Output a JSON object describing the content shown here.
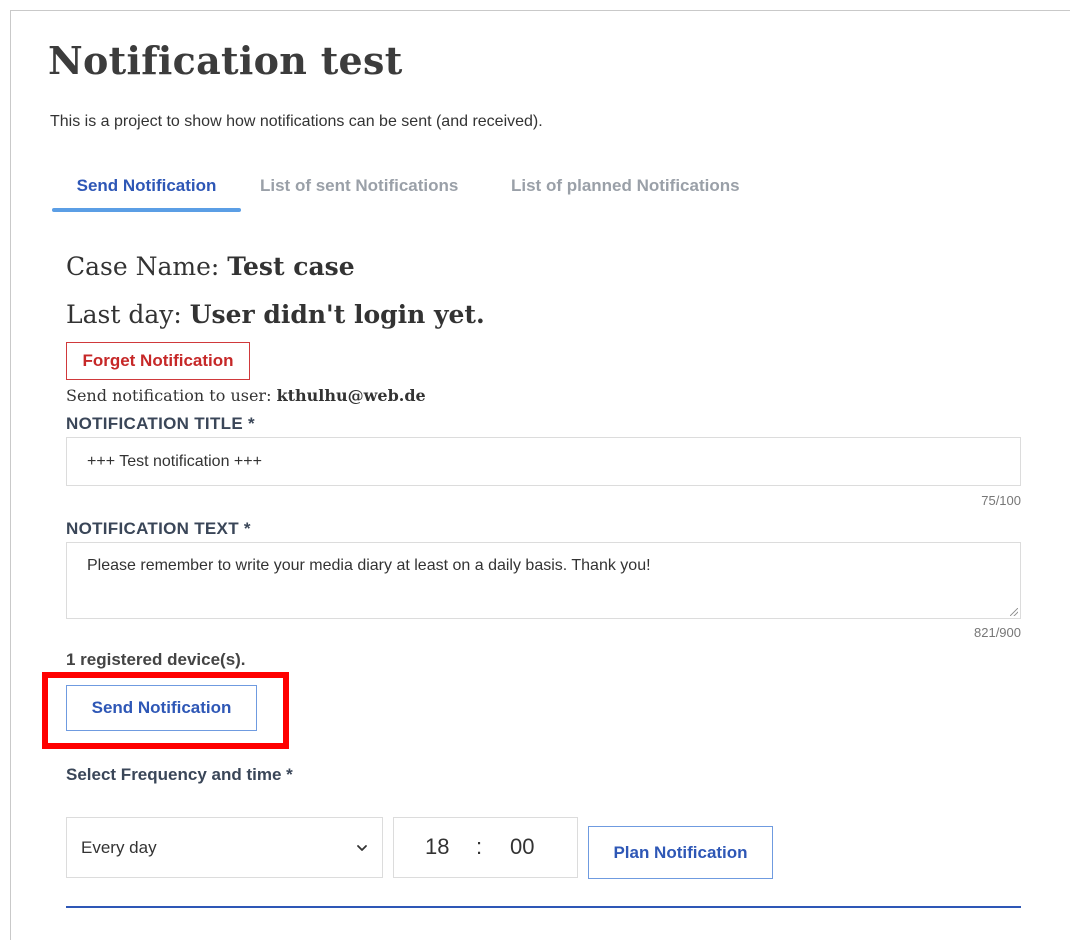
{
  "page": {
    "title": "Notification test",
    "description": "This is a project to show how notifications can be sent (and received)."
  },
  "tabs": [
    {
      "label": "Send Notification",
      "active": true
    },
    {
      "label": "List of sent Notifications",
      "active": false
    },
    {
      "label": "List of planned Notifications",
      "active": false
    }
  ],
  "case": {
    "name_label": "Case Name:",
    "name_value": "Test case",
    "lastday_label": "Last day:",
    "lastday_value": "User didn't login yet."
  },
  "forget_button": "Forget Notification",
  "recipient": {
    "label": "Send notification to user:",
    "email": "kthulhu@web.de"
  },
  "form": {
    "title_label": "NOTIFICATION TITLE *",
    "title_value": "+++ Test notification +++",
    "title_counter": "75/100",
    "text_label": "NOTIFICATION TEXT *",
    "text_value": "Please remember to write your media diary at least on a daily basis. Thank you!",
    "text_counter": "821/900"
  },
  "devices_text": "1 registered device(s).",
  "send_button": "Send Notification",
  "schedule": {
    "label": "Select Frequency and time *",
    "frequency_selected": "Every day",
    "hour": "18",
    "separator": ":",
    "minute": "00",
    "plan_button": "Plan Notification"
  },
  "colors": {
    "accent": "#2e57b6",
    "tab_underline": "#5b9ee5",
    "danger": "#c62828",
    "highlight": "#ff0000"
  }
}
